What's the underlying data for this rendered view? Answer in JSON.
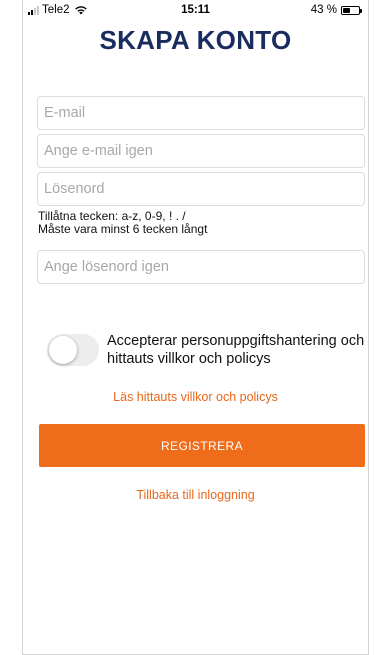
{
  "status_bar": {
    "carrier": "Tele2",
    "time": "15:11",
    "battery_percent": "43 %",
    "battery_level": 0.43,
    "icons": [
      "signal-icon",
      "wifi-icon",
      "battery-icon"
    ]
  },
  "page": {
    "title": "SKAPA KONTO"
  },
  "form": {
    "email_placeholder": "E-mail",
    "email_confirm_placeholder": "Ange e-mail igen",
    "password_placeholder": "Lösenord",
    "password_hint_line1": "Tillåtna tecken: a-z, 0-9, ! . /",
    "password_hint_line2": "Måste vara minst 6 tecken långt",
    "password_confirm_placeholder": "Ange lösenord igen",
    "accept_label": "Accepterar personuppgiftshantering och hittauts villkor och policys",
    "accept_toggle_on": false,
    "terms_link": "Läs hittauts villkor och policys",
    "register_button": "REGISTRERA",
    "back_link": "Tillbaka till inloggning"
  },
  "colors": {
    "title": "#1a2b5e",
    "accent": "#ef6d1a",
    "link": "#e8671b"
  }
}
